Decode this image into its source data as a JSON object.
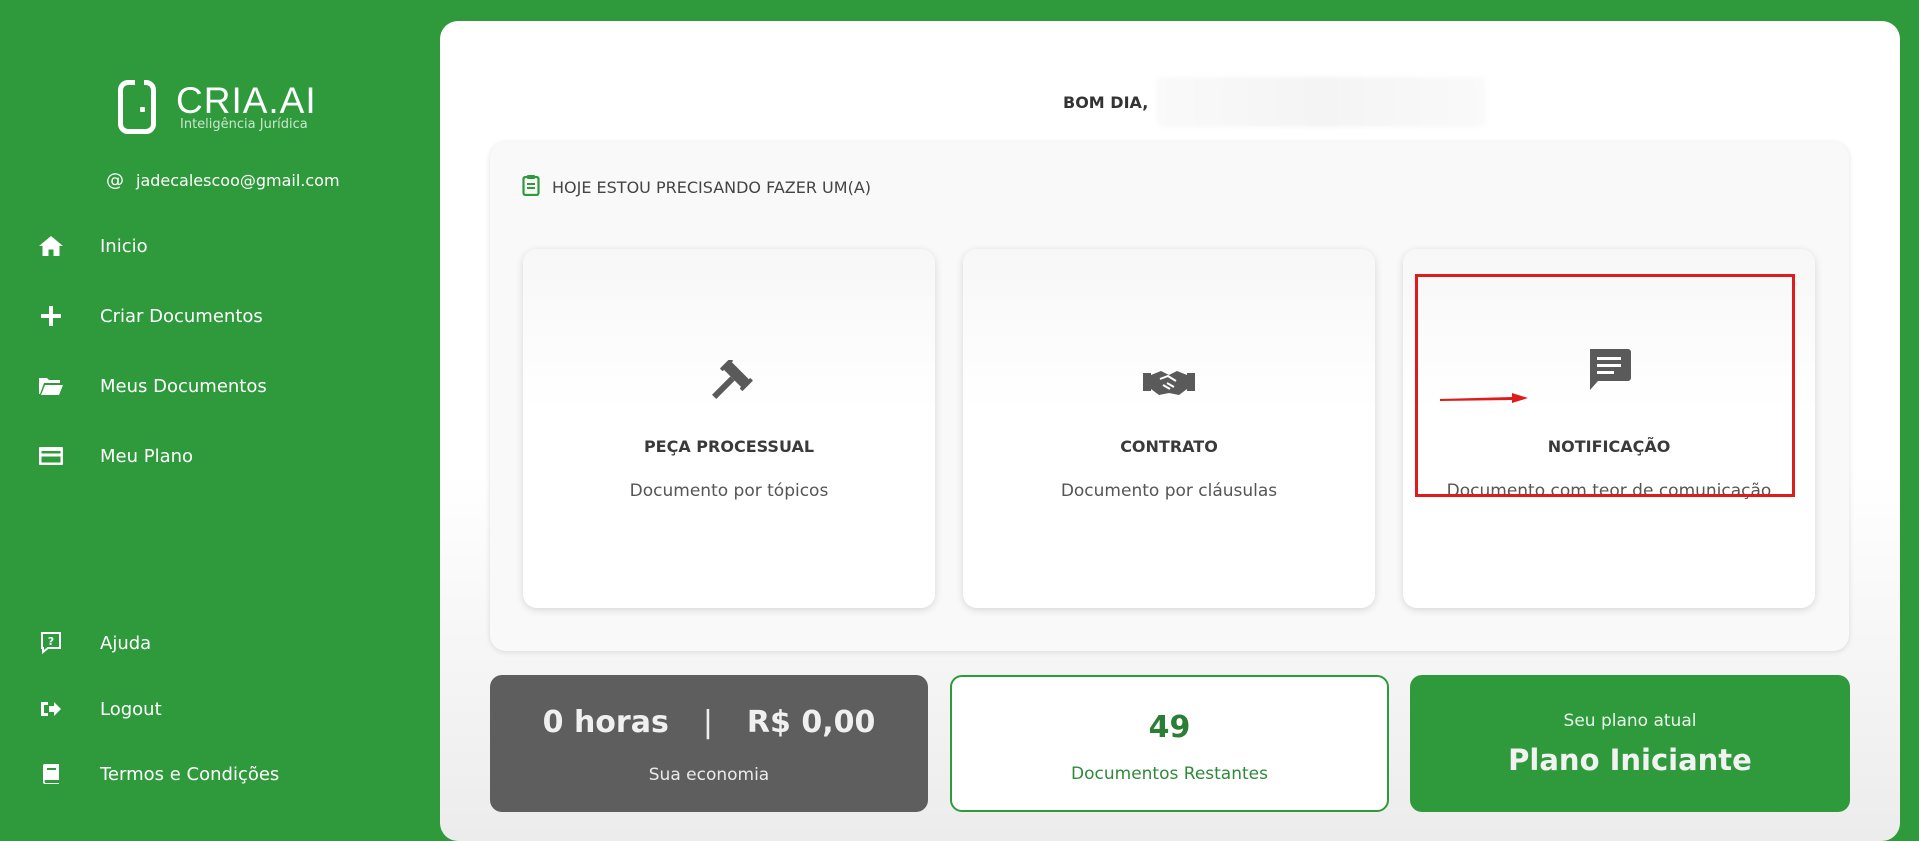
{
  "brand": {
    "name": "CRIA.AI",
    "tagline": "Inteligência Jurídica"
  },
  "user": {
    "email": "jadecalescoo@gmail.com"
  },
  "sidebar": {
    "items": [
      {
        "label": "Inicio",
        "icon": "home-icon"
      },
      {
        "label": "Criar Documentos",
        "icon": "plus-icon"
      },
      {
        "label": "Meus Documentos",
        "icon": "folder-icon"
      },
      {
        "label": "Meu Plano",
        "icon": "credit-card-icon"
      }
    ],
    "bottom_items": [
      {
        "label": "Ajuda",
        "icon": "help-icon"
      },
      {
        "label": "Logout",
        "icon": "logout-icon"
      },
      {
        "label": "Termos e Condições",
        "icon": "book-icon"
      }
    ]
  },
  "main": {
    "greeting": "BOM DIA,",
    "picker": {
      "heading": "HOJE ESTOU PRECISANDO FAZER UM(A)",
      "cards": [
        {
          "title": "PEÇA PROCESSUAL",
          "description": "Documento por tópicos",
          "icon": "gavel-icon"
        },
        {
          "title": "CONTRATO",
          "description": "Documento por cláusulas",
          "icon": "handshake-icon"
        },
        {
          "title": "NOTIFICAÇÃO",
          "description": "Documento com teor de comunicação",
          "icon": "message-icon"
        }
      ]
    },
    "stats": {
      "economy_hours": "0 horas",
      "economy_separator": "|",
      "economy_money": "R$ 0,00",
      "economy_label": "Sua economia",
      "documents_remaining": "49",
      "documents_label": "Documentos Restantes",
      "plan_label": "Seu plano atual",
      "plan_name": "Plano Iniciante"
    }
  },
  "colors": {
    "brand_green": "#2e9a3c",
    "highlight_red": "#e01b1b",
    "dark_card": "#5e5e5e"
  }
}
